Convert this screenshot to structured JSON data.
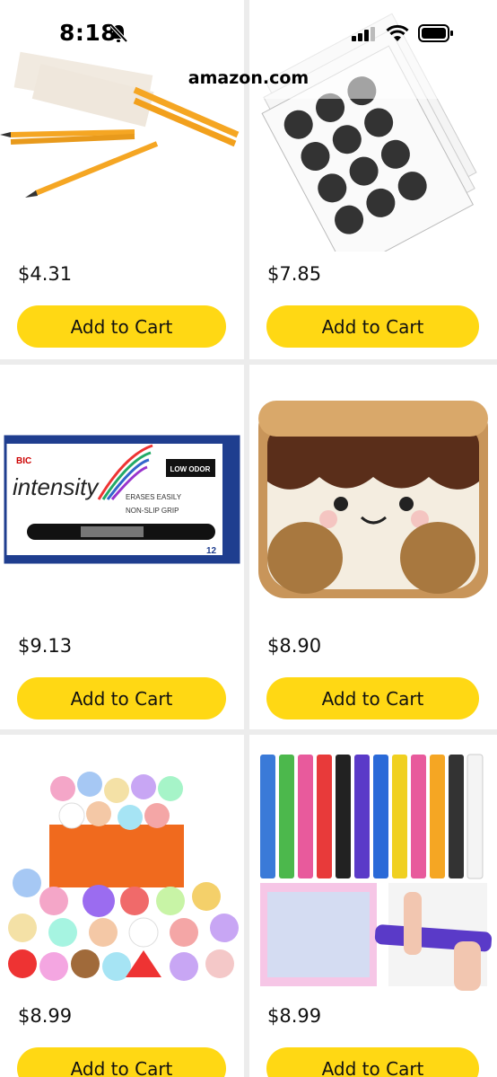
{
  "status": {
    "time": "8:18"
  },
  "browser": {
    "url": "amazon.com"
  },
  "products": [
    {
      "price": "$4.31",
      "button": "Add to Cart",
      "image": "pencils-image"
    },
    {
      "price": "$7.85",
      "button": "Add to Cart",
      "image": "stickers-image"
    },
    {
      "price": "$9.13",
      "button": "Add to Cart",
      "image": "markers-image"
    },
    {
      "price": "$8.90",
      "button": "Add to Cart",
      "image": "smore-plush-image"
    },
    {
      "price": "$8.99",
      "button": "Add to Cart",
      "image": "squishy-toys-image"
    },
    {
      "price": "$8.99",
      "button": "Add to Cart",
      "image": "slap-bracelets-image"
    }
  ],
  "marker_box": {
    "brand": "BIC",
    "name": "intensity",
    "badge": "LOW ODOR",
    "feature1": "ERASES EASILY",
    "feature2": "NON-SLIP GRIP",
    "count": "12"
  },
  "colors": {
    "button": "#ffd814",
    "background": "#ececec",
    "card": "#ffffff"
  }
}
